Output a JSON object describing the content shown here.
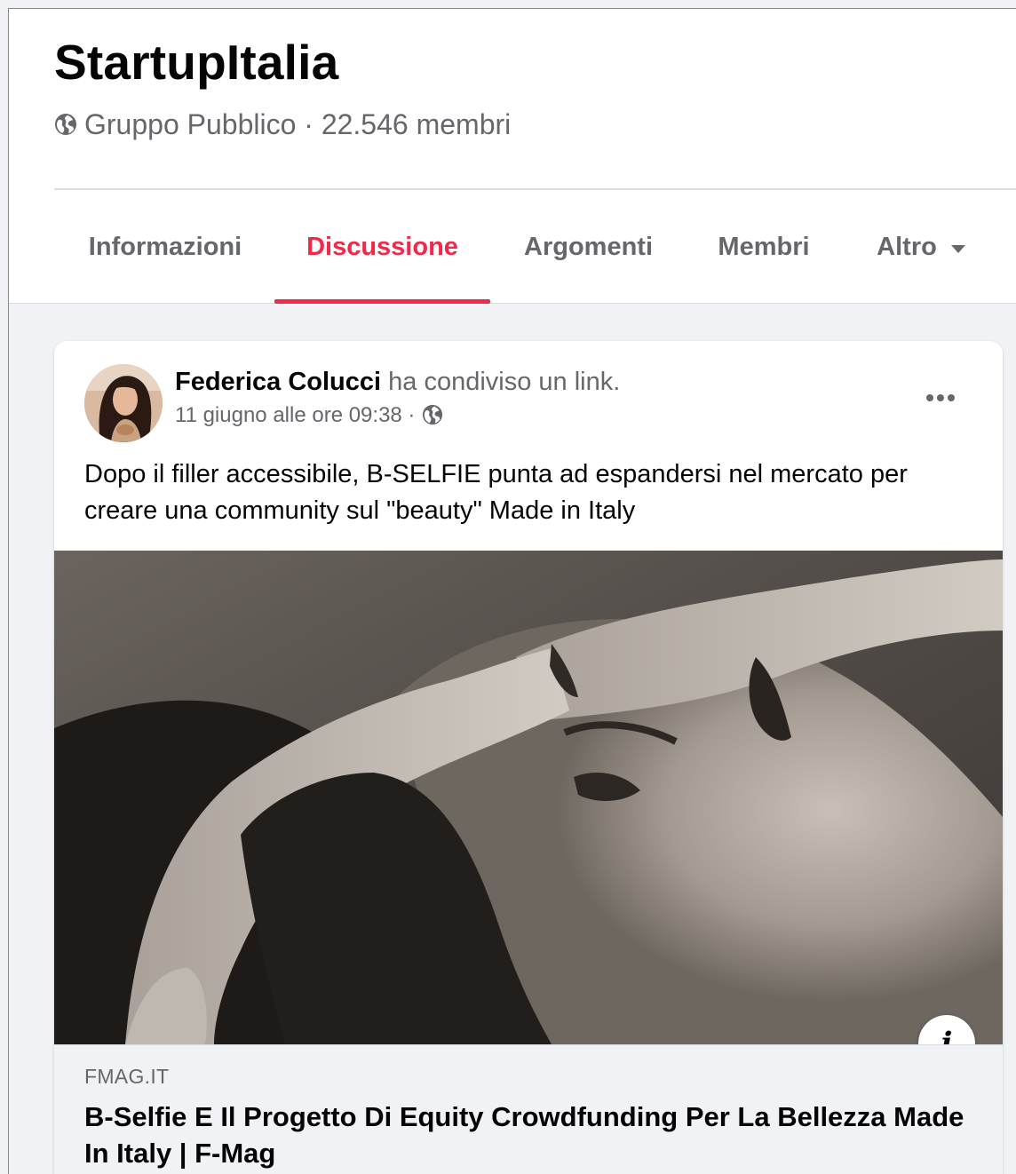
{
  "group": {
    "name": "StartupItalia",
    "privacy": "Gruppo Pubblico",
    "separator": " · ",
    "members": "22.546 membri"
  },
  "tabs": [
    {
      "label": "Informazioni",
      "active": false
    },
    {
      "label": "Discussione",
      "active": true
    },
    {
      "label": "Argomenti",
      "active": false
    },
    {
      "label": "Membri",
      "active": false
    },
    {
      "label": "Altro",
      "active": false
    }
  ],
  "post": {
    "author": "Federica Colucci",
    "action": "ha condiviso un link.",
    "timestamp": "11 giugno alle ore 09:38 ·",
    "text": "Dopo il filler accessibile, B-SELFIE punta ad espandersi nel mercato per creare una community sul \"beauty\" Made in Italy",
    "link": {
      "domain": "FMAG.IT",
      "title": "B-Selfie E Il Progetto Di Equity Crowdfunding Per La Bellezza Made In Italy | F-Mag"
    },
    "info_label": "i"
  },
  "colors": {
    "accent": "#f02849",
    "secondary_text": "#65676b",
    "primary_text": "#050505",
    "background": "#f0f2f5"
  },
  "icons": [
    "globe-icon",
    "more-icon",
    "caret-down-icon",
    "info-icon"
  ]
}
